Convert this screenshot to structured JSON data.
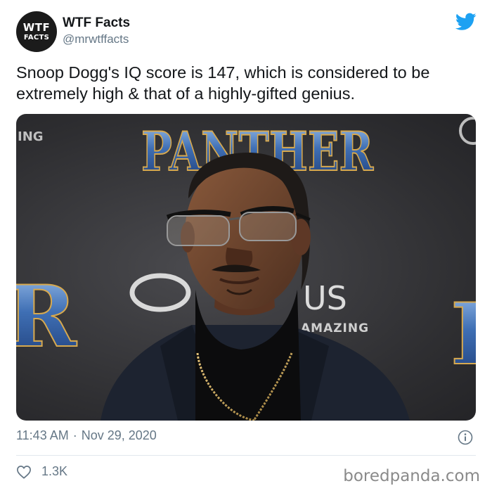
{
  "account": {
    "avatar_line1": "WTF",
    "avatar_line2": "FACTS",
    "display_name": "WTF Facts",
    "handle": "@mrwtffacts"
  },
  "tweet": {
    "text": "Snoop Dogg's IQ score is 147, which is considered to be extremely high & that of a highly-gifted genius.",
    "time": "11:43 AM",
    "separator": "·",
    "date": "Nov 29, 2020",
    "like_count": "1.3K"
  },
  "photo": {
    "banner_title": "PANTHER",
    "left_edge_text": "ING",
    "right_brand_text": "US",
    "tagline_text": "AMAZING",
    "left_letter": "R",
    "right_letter": "P"
  },
  "watermark": "boredpanda.com",
  "colors": {
    "twitter_blue": "#1da1f2",
    "secondary_text": "#657786",
    "banner_blue": "#3f6fb4"
  },
  "icons": [
    "twitter-bird-icon",
    "info-icon",
    "heart-icon"
  ]
}
